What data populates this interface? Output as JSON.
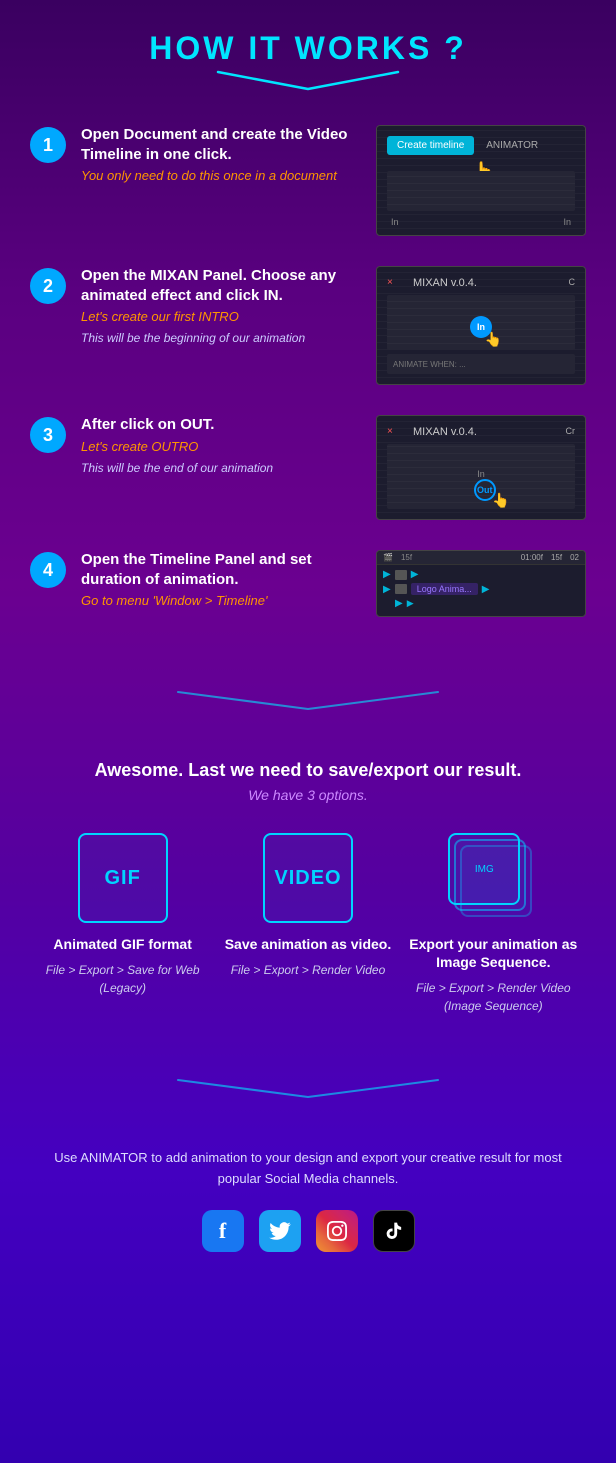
{
  "header": {
    "title": "HOW IT WORKS ?"
  },
  "steps": [
    {
      "number": "1",
      "title": "Open Document and create the Video Timeline in one click.",
      "subtitle": "You only need to do this once in a document",
      "description": "",
      "panel_type": "timeline_create"
    },
    {
      "number": "2",
      "title": "Open the MIXAN Panel. Choose any animated effect and click IN.",
      "subtitle": "Let's create our first INTRO",
      "description": "This will be the beginning of our animation",
      "panel_type": "mixan_in"
    },
    {
      "number": "3",
      "title": "After click on OUT.",
      "subtitle": "Let's create OUTRO",
      "description": "This will be the end of our animation",
      "panel_type": "mixan_out"
    },
    {
      "number": "4",
      "title": "Open the Timeline Panel and set duration of animation.",
      "subtitle": "Go to menu 'Window > Timeline'",
      "description": "",
      "panel_type": "timeline_panel"
    }
  ],
  "export": {
    "intro": "Awesome. Last we need to save/export our result.",
    "subtitle": "We have 3 options.",
    "options": [
      {
        "icon_text": "GIF",
        "title": "Animated GIF format",
        "path": "File > Export > Save for Web (Legacy)"
      },
      {
        "icon_text": "VIDEO",
        "title": "Save animation as video.",
        "path": "File > Export > Render Video"
      },
      {
        "icon_text": "IMG",
        "title": "Export your animation as Image Sequence.",
        "path": "File > Export > Render Video (Image Sequence)"
      }
    ]
  },
  "footer": {
    "text": "Use ANIMATOR to add animation to your design and export your creative result for most popular Social Media channels.",
    "social": [
      {
        "name": "facebook",
        "label": "f"
      },
      {
        "name": "twitter",
        "label": "🐦"
      },
      {
        "name": "instagram",
        "label": "📷"
      },
      {
        "name": "tiktok",
        "label": "♪"
      }
    ]
  },
  "colors": {
    "accent_cyan": "#00e5ff",
    "accent_orange": "#ff9500",
    "step_number_bg": "#00a8ff",
    "btn_create": "#00b4d8"
  }
}
